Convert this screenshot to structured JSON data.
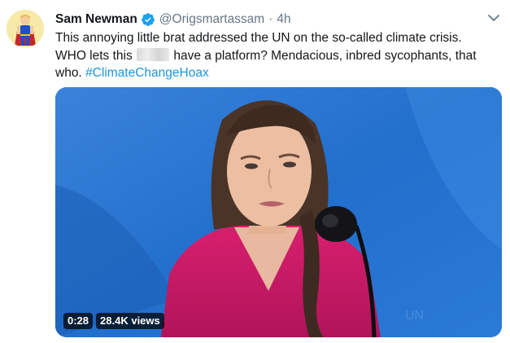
{
  "tweet": {
    "display_name": "Sam Newman",
    "handle": "@Origsmartassam",
    "separator": "·",
    "time": "4h",
    "verified_icon": "verified-badge-icon",
    "text": {
      "line1": "This annoying little brat addressed the UN on the so-called climate crisis.",
      "line2_before": "WHO lets this",
      "line2_after": "have a platform? Mendacious, inbred sycophants, that",
      "line3": "who.",
      "hashtag": "#ClimateChangeHoax"
    },
    "media": {
      "duration": "0:28",
      "views": "28.4K views"
    }
  },
  "colors": {
    "link": "#1b95e0",
    "verified": "#1da1f2",
    "secondary_text": "#657786"
  }
}
